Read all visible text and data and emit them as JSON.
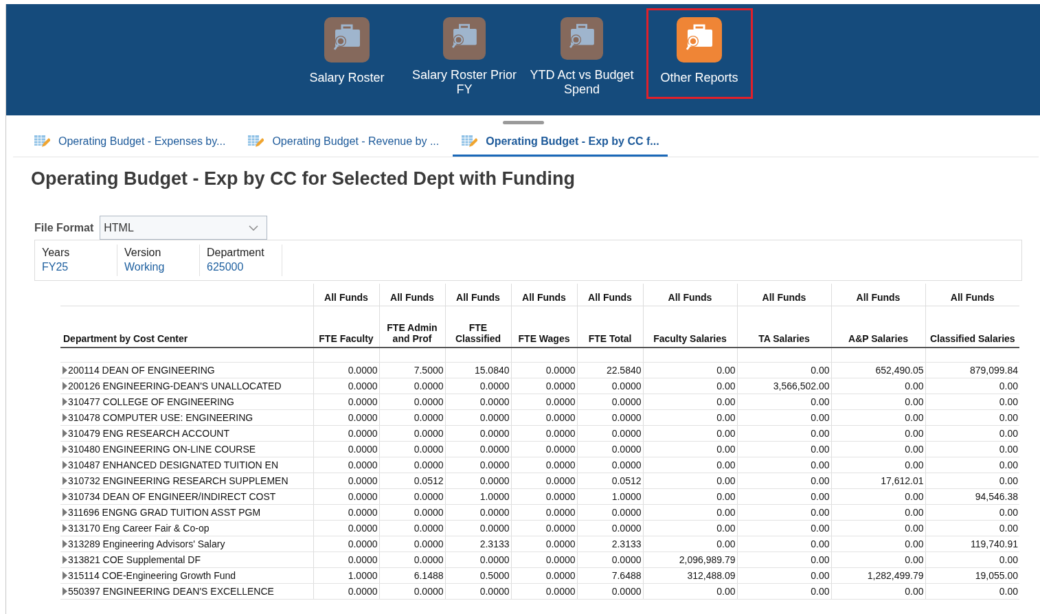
{
  "launcher": [
    {
      "label": "Salary Roster",
      "selected": false
    },
    {
      "label": "Salary Roster Prior FY",
      "selected": false
    },
    {
      "label": "YTD Act vs Budget Spend",
      "selected": false
    },
    {
      "label": "Other Reports",
      "selected": true
    }
  ],
  "tabs": [
    {
      "label": "Operating Budget - Expenses by...",
      "selected": false
    },
    {
      "label": "Operating Budget - Revenue by ...",
      "selected": false
    },
    {
      "label": "Operating Budget - Exp by CC f...",
      "selected": true
    }
  ],
  "title": "Operating Budget - Exp by CC for Selected Dept with Funding",
  "file_format": {
    "label": "File Format",
    "value": "HTML"
  },
  "parameters": [
    {
      "label": "Years",
      "value": "FY25"
    },
    {
      "label": "Version",
      "value": "Working"
    },
    {
      "label": "Department",
      "value": "625000"
    }
  ],
  "table": {
    "fund_headers": [
      "All Funds",
      "All Funds",
      "All Funds",
      "All Funds",
      "All Funds",
      "All Funds",
      "All Funds",
      "All Funds",
      "All Funds"
    ],
    "columns": [
      "Department by Cost Center",
      "FTE Faculty",
      "FTE Admin and Prof",
      "FTE Classified",
      "FTE Wages",
      "FTE Total",
      "Faculty Salaries",
      "TA Salaries",
      "A&P Salaries",
      "Classified Salaries"
    ],
    "rows": [
      {
        "name": "200114 DEAN OF ENGINEERING",
        "values": [
          "0.0000",
          "7.5000",
          "15.0840",
          "0.0000",
          "22.5840",
          "0.00",
          "0.00",
          "652,490.05",
          "879,099.84"
        ]
      },
      {
        "name": "200126 ENGINEERING-DEAN'S UNALLOCATED",
        "values": [
          "0.0000",
          "0.0000",
          "0.0000",
          "0.0000",
          "0.0000",
          "0.00",
          "3,566,502.00",
          "0.00",
          "0.00"
        ]
      },
      {
        "name": "310477 COLLEGE OF ENGINEERING",
        "values": [
          "0.0000",
          "0.0000",
          "0.0000",
          "0.0000",
          "0.0000",
          "0.00",
          "0.00",
          "0.00",
          "0.00"
        ]
      },
      {
        "name": "310478 COMPUTER USE: ENGINEERING",
        "values": [
          "0.0000",
          "0.0000",
          "0.0000",
          "0.0000",
          "0.0000",
          "0.00",
          "0.00",
          "0.00",
          "0.00"
        ]
      },
      {
        "name": "310479 ENG RESEARCH ACCOUNT",
        "values": [
          "0.0000",
          "0.0000",
          "0.0000",
          "0.0000",
          "0.0000",
          "0.00",
          "0.00",
          "0.00",
          "0.00"
        ]
      },
      {
        "name": "310480 ENGINEERING ON-LINE COURSE",
        "values": [
          "0.0000",
          "0.0000",
          "0.0000",
          "0.0000",
          "0.0000",
          "0.00",
          "0.00",
          "0.00",
          "0.00"
        ]
      },
      {
        "name": "310487 ENHANCED DESIGNATED TUITION EN",
        "values": [
          "0.0000",
          "0.0000",
          "0.0000",
          "0.0000",
          "0.0000",
          "0.00",
          "0.00",
          "0.00",
          "0.00"
        ]
      },
      {
        "name": "310732 ENGINEERING RESEARCH SUPPLEMEN",
        "values": [
          "0.0000",
          "0.0512",
          "0.0000",
          "0.0000",
          "0.0512",
          "0.00",
          "0.00",
          "17,612.01",
          "0.00"
        ]
      },
      {
        "name": "310734 DEAN OF ENGINEER/INDIRECT COST",
        "values": [
          "0.0000",
          "0.0000",
          "1.0000",
          "0.0000",
          "1.0000",
          "0.00",
          "0.00",
          "0.00",
          "94,546.38"
        ]
      },
      {
        "name": "311696 ENGNG GRAD TUITION ASST PGM",
        "values": [
          "0.0000",
          "0.0000",
          "0.0000",
          "0.0000",
          "0.0000",
          "0.00",
          "0.00",
          "0.00",
          "0.00"
        ]
      },
      {
        "name": "313170 Eng Career Fair & Co-op",
        "values": [
          "0.0000",
          "0.0000",
          "0.0000",
          "0.0000",
          "0.0000",
          "0.00",
          "0.00",
          "0.00",
          "0.00"
        ]
      },
      {
        "name": "313289 Engineering Advisors' Salary",
        "values": [
          "0.0000",
          "0.0000",
          "2.3133",
          "0.0000",
          "2.3133",
          "0.00",
          "0.00",
          "0.00",
          "119,740.91"
        ]
      },
      {
        "name": "313821 COE Supplemental DF",
        "values": [
          "0.0000",
          "0.0000",
          "0.0000",
          "0.0000",
          "0.0000",
          "2,096,989.79",
          "0.00",
          "0.00",
          "0.00"
        ]
      },
      {
        "name": "315114 COE-Engineering Growth Fund",
        "values": [
          "1.0000",
          "6.1488",
          "0.5000",
          "0.0000",
          "7.6488",
          "312,488.09",
          "0.00",
          "1,282,499.79",
          "19,055.00"
        ]
      },
      {
        "name": "550397 ENGINEERING DEAN'S EXCELLENCE",
        "values": [
          "0.0000",
          "0.0000",
          "0.0000",
          "0.0000",
          "0.0000",
          "0.00",
          "0.00",
          "0.00",
          "0.00"
        ]
      }
    ]
  }
}
